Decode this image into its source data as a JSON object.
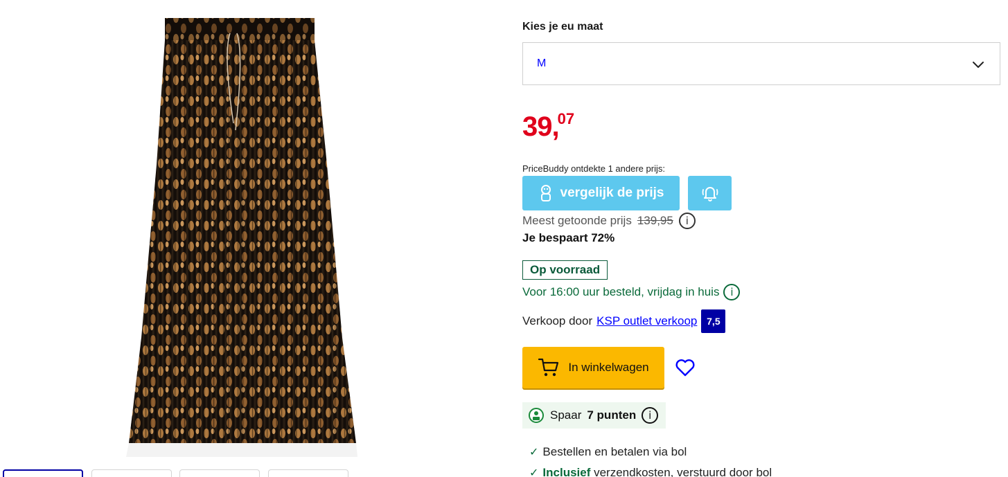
{
  "size": {
    "label": "Kies je eu maat",
    "selected": "M"
  },
  "price": {
    "main": "39,",
    "cents": "07",
    "color": "#e0001b"
  },
  "pricebuddy": {
    "text": "PriceBuddy ontdekte 1 andere prijs:",
    "compare_label": "vergelijk de prijs",
    "compare_icon": "pricebuddy-mascot-icon",
    "alert_icon": "bell-icon",
    "color": "#5dc8ee"
  },
  "was": {
    "label": "Meest getoonde prijs",
    "price": "139,95",
    "info": "i"
  },
  "savings": "Je bespaart 72%",
  "stock": {
    "badge": "Op voorraad",
    "delivery": "Voor 16:00 uur besteld, vrijdag in huis",
    "info": "i"
  },
  "seller": {
    "prefix": "Verkoop door",
    "name": "KSP outlet verkoop",
    "score": "7,5"
  },
  "cart": {
    "label": "In winkelwagen",
    "icon": "cart-icon",
    "color": "#fbb800"
  },
  "wishlist_icon": "heart-icon",
  "points": {
    "prefix": "Spaar",
    "amount": "7 punten",
    "info": "i"
  },
  "usps": [
    {
      "text": "Bestellen en betalen via bol"
    },
    {
      "bold": "Inclusief",
      "text": " verzendkosten, verstuurd door bol"
    }
  ],
  "check_icon": "✓"
}
